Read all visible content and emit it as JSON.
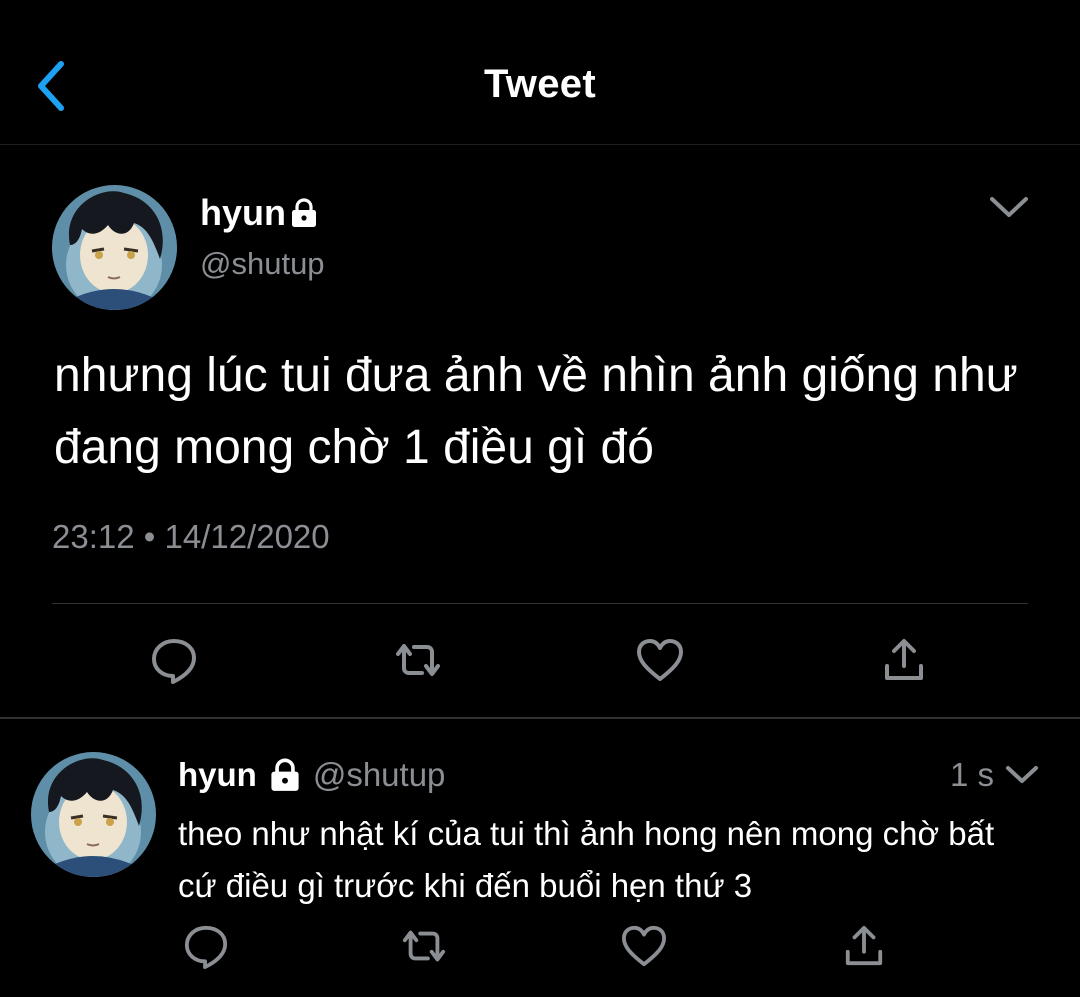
{
  "header": {
    "title": "Tweet",
    "back_icon": "chevron-left-icon",
    "accent_color": "#1da1f2"
  },
  "main_tweet": {
    "author_name": "hyun",
    "handle": "@shutup",
    "text": "nhưng lúc tui đưa ảnh về nhìn ảnh giống như đang mong chờ 1 điều gì đó",
    "timestamp": "23:12 • 14/12/2020",
    "icons": {
      "lock": "lock-icon",
      "menu": "chevron-down-icon",
      "reply": "comment-icon",
      "retweet": "retweet-icon",
      "like": "heart-icon",
      "share": "share-icon"
    }
  },
  "reply_tweet": {
    "author_name": "hyun",
    "handle": "@shutup",
    "time": "1 s",
    "text": "theo như nhật kí của tui thì ảnh hong nên mong chờ bất cứ điều gì trước khi đến buổi hẹn thứ 3",
    "icons": {
      "lock": "lock-icon",
      "menu": "chevron-down-icon",
      "reply": "comment-icon",
      "retweet": "retweet-icon",
      "like": "heart-icon",
      "share": "share-icon"
    }
  },
  "colors": {
    "background": "#000000",
    "text_primary": "#ffffff",
    "text_secondary": "#8b8f94",
    "divider": "#2f3336"
  }
}
